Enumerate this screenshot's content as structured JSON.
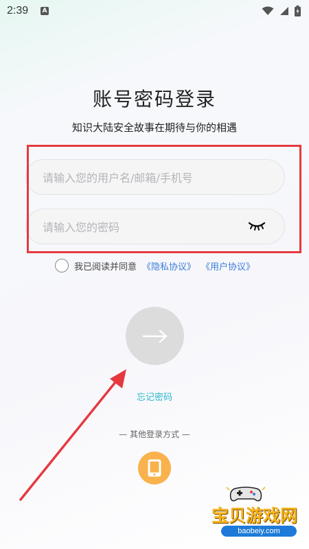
{
  "status_bar": {
    "time": "2:39",
    "indicator": "A",
    "icons": [
      "wifi-icon",
      "signal-icon",
      "battery-icon"
    ]
  },
  "login": {
    "title": "账号密码登录",
    "subtitle": "知识大陆安全故事在期待与你的相遇",
    "username_placeholder": "请输入您的用户名/邮箱/手机号",
    "password_placeholder": "请输入您的密码",
    "agree_prefix": "我已阅读并同意",
    "privacy_link": "《隐私协议》",
    "user_link": "《用户协议》",
    "forgot_password": "忘记密码",
    "other_methods": "— 其他登录方式 —"
  },
  "watermark": {
    "text_cn": "宝贝游戏网",
    "url": "baobeiy.com"
  },
  "colors": {
    "highlight": "#e5393f",
    "link": "#3a7cd9",
    "forgot": "#2bb8c8",
    "phone_button": "#f9b24c",
    "submit_disabled": "#dcdcdc"
  }
}
